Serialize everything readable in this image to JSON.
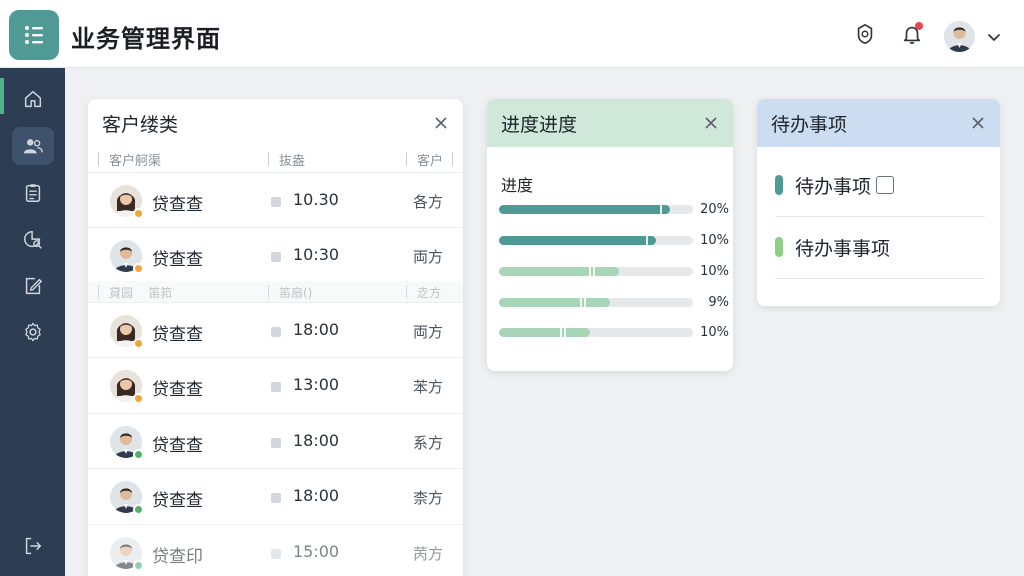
{
  "app": {
    "title": "业务管理界面"
  },
  "header": {
    "notification_badge_color": "#e5484d"
  },
  "sidebar": {
    "items": [
      {
        "icon": "home-icon",
        "active": false
      },
      {
        "icon": "users-icon",
        "active": true
      },
      {
        "icon": "clipboard-icon",
        "active": false
      },
      {
        "icon": "chart-search-icon",
        "active": false
      },
      {
        "icon": "edit-icon",
        "active": false
      },
      {
        "icon": "gear-icon",
        "active": false
      }
    ],
    "logout_icon": "logout-icon"
  },
  "customers": {
    "title": "客户缕类",
    "columns": [
      "客户舸渠",
      "抜盎",
      "客户"
    ],
    "columns2": [
      "貸园",
      "笛筘",
      "笛扇()",
      "赱方"
    ],
    "rows": [
      {
        "name": "贷查查",
        "time": "10.30",
        "party": "各方",
        "gender": "f",
        "status": "#f0a53a"
      },
      {
        "name": "贷查查",
        "time": "10:30",
        "party": "両方",
        "gender": "m",
        "status": "#f0a53a"
      },
      {
        "name": "贷查查",
        "time": "18:00",
        "party": "両方",
        "gender": "f",
        "status": "#f0a53a"
      },
      {
        "name": "贷查查",
        "time": "13:00",
        "party": "苯方",
        "gender": "f",
        "status": "#f0a53a"
      },
      {
        "name": "贷查查",
        "time": "18:00",
        "party": "系方",
        "gender": "m",
        "status": "#4fb36a"
      },
      {
        "name": "贷查查",
        "time": "18:00",
        "party": "柰方",
        "gender": "m",
        "status": "#4fb36a"
      },
      {
        "name": "贷查印",
        "time": "15:00",
        "party": "苪方",
        "gender": "m",
        "status": "#4fb36a"
      }
    ]
  },
  "progress": {
    "title": "进度进度",
    "label": "进度",
    "items": [
      {
        "fill": 0.88,
        "pct": "20%",
        "color": "#4f9a95"
      },
      {
        "fill": 0.81,
        "pct": "10%",
        "color": "#4f9a95"
      },
      {
        "fill": 0.62,
        "pct": "10%",
        "color": "#a8d4b8"
      },
      {
        "fill": 0.57,
        "pct": "9%",
        "color": "#a8d4b8"
      },
      {
        "fill": 0.47,
        "pct": "10%",
        "color": "#a8d4b8"
      }
    ]
  },
  "todo": {
    "title": "待办事项",
    "items": [
      {
        "text": "待办事项",
        "bar_color": "#4f9a95",
        "checkbox": true
      },
      {
        "text": "待办事事项",
        "bar_color": "#8ccf85",
        "checkbox": false
      }
    ]
  },
  "colors": {
    "accent": "#4f9a95",
    "sidebar": "#2c3d54",
    "progress_header": "#cfe8d9",
    "todo_header": "#cdddf1"
  }
}
